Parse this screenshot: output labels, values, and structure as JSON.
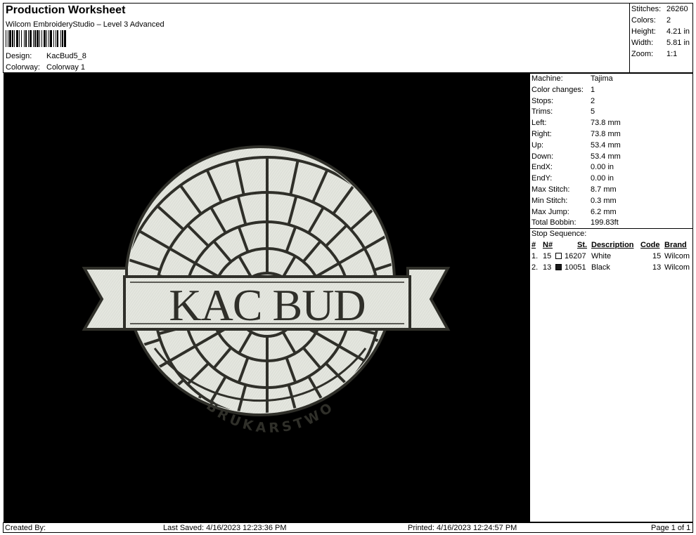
{
  "header": {
    "title": "Production Worksheet",
    "subtitle": "Wilcom EmbroideryStudio – Level 3 Advanced",
    "design_label": "Design:",
    "design_value": "KacBud5_8",
    "colorway_label": "Colorway:",
    "colorway_value": "Colorway 1"
  },
  "summary": {
    "stitches_label": "Stitches:",
    "stitches_value": "26260",
    "colors_label": "Colors:",
    "colors_value": "2",
    "height_label": "Height:",
    "height_value": "4.21 in",
    "width_label": "Width:",
    "width_value": "5.81 in",
    "zoom_label": "Zoom:",
    "zoom_value": "1:1"
  },
  "design": {
    "main_text": "KAC BUD",
    "arc_text": "BRUKARSTWO",
    "background_color": "#000000",
    "thread_light": "#e4e6df",
    "thread_dark": "#2f2f29"
  },
  "details": {
    "machine_label": "Machine:",
    "machine_value": "Tajima",
    "color_changes_label": "Color changes:",
    "color_changes_value": "1",
    "stops_label": "Stops:",
    "stops_value": "2",
    "trims_label": "Trims:",
    "trims_value": "5",
    "left_label": "Left:",
    "left_value": "73.8 mm",
    "right_label": "Right:",
    "right_value": "73.8 mm",
    "up_label": "Up:",
    "up_value": "53.4 mm",
    "down_label": "Down:",
    "down_value": "53.4 mm",
    "endx_label": "EndX:",
    "endx_value": "0.00 in",
    "endy_label": "EndY:",
    "endy_value": "0.00 in",
    "max_stitch_label": "Max Stitch:",
    "max_stitch_value": "8.7 mm",
    "min_stitch_label": "Min Stitch:",
    "min_stitch_value": "0.3 mm",
    "max_jump_label": "Max Jump:",
    "max_jump_value": "6.2 mm",
    "total_bobbin_label": "Total Bobbin:",
    "total_bobbin_value": "199.83ft"
  },
  "stop_sequence": {
    "title": "Stop Sequence:",
    "headers": {
      "num": "#",
      "n": "N#",
      "st": "St.",
      "description": "Description",
      "code": "Code",
      "brand": "Brand"
    },
    "rows": [
      {
        "num": "1.",
        "n": "15",
        "swatch": "#ffffff",
        "st": "16207",
        "description": "White",
        "code": "15",
        "brand": "Wilcom"
      },
      {
        "num": "2.",
        "n": "13",
        "swatch": "#1a1a1a",
        "st": "10051",
        "description": "Black",
        "code": "13",
        "brand": "Wilcom"
      }
    ]
  },
  "footer": {
    "created_by": "Created By:",
    "last_saved": "Last Saved: 4/16/2023 12:23:36 PM",
    "printed": "Printed: 4/16/2023 12:24:57 PM",
    "page": "Page 1 of 1"
  }
}
